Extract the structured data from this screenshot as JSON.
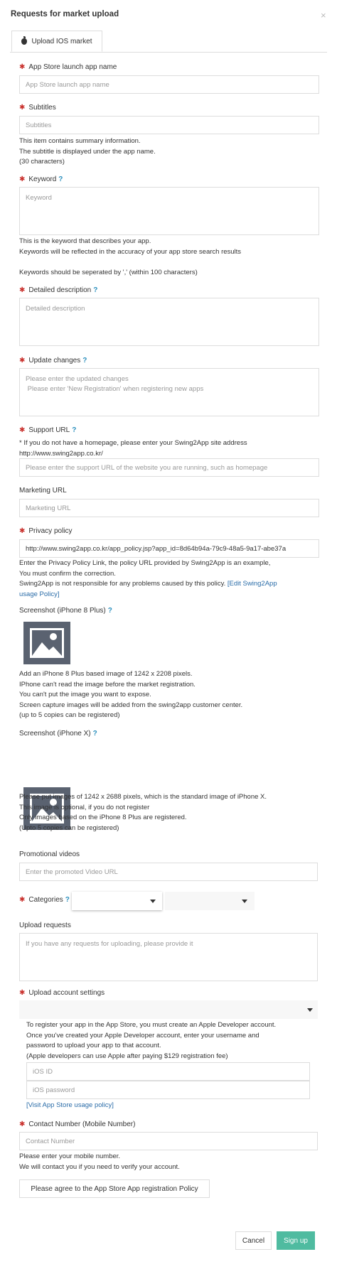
{
  "modal": {
    "title": "Requests for market upload",
    "close": "×"
  },
  "tab": {
    "label": "Upload IOS market"
  },
  "app_name": {
    "label": "App Store launch app name",
    "placeholder": "App Store launch app name"
  },
  "subtitles": {
    "label": "Subtitles",
    "placeholder": "Subtitles",
    "help": [
      "This item contains summary information.",
      "The subtitle is displayed under the app name.",
      "(30 characters)"
    ]
  },
  "keyword": {
    "label": "Keyword",
    "help_mark": "?",
    "placeholder": "Keyword",
    "help": [
      "This is the keyword that describes your app.",
      "Keywords will be reflected in the accuracy of your app store search results"
    ],
    "help2": "Keywords should be seperated by ',' (within 100 characters)"
  },
  "description": {
    "label": "Detailed description",
    "help_mark": "?",
    "placeholder": "Detailed description"
  },
  "update_changes": {
    "label": "Update changes",
    "help_mark": "?",
    "placeholder_1": "Please enter the updated changes",
    "placeholder_2": " Please enter 'New Registration' when registering new apps"
  },
  "support_url": {
    "label": "Support URL",
    "help_mark": "?",
    "note_1": "* If you do not have a homepage, please enter your Swing2App site address",
    "note_2": "http://www.swing2app.co.kr/",
    "placeholder": "Please enter the support URL of the website you are running, such as homepage"
  },
  "marketing_url": {
    "label": "Marketing URL",
    "placeholder": "Marketing URL"
  },
  "privacy_policy": {
    "label": "Privacy policy",
    "value": "http://www.swing2app.co.kr/app_policy.jsp?app_id=8d64b94a-79c9-48a5-9a17-abe37a",
    "help_1": "Enter the Privacy Policy Link, the policy URL provided by Swing2App is an example,",
    "help_2": "You must confirm the correction.",
    "help_3": "Swing2App is not responsible for any problems caused by this policy.",
    "link_1": "[Edit Swing2App",
    "link_2": "usage Policy]"
  },
  "screenshot_8plus": {
    "label": "Screenshot (iPhone 8 Plus)",
    "help_mark": "?",
    "help": [
      "Add an iPhone 8 Plus based image of 1242 x 2208 pixels.",
      "IPhone can't read the image before the market registration.",
      "You can't put the image you want to expose.",
      "Screen capture images will be added from the swing2app customer center.",
      "(up to 5 copies can be registered)"
    ]
  },
  "screenshot_x": {
    "label": "Screenshot (iPhone X)",
    "help_mark": "?",
    "help": [
      "Please put images of 1242 x 2688 pixels, which is the standard image of iPhone X.",
      "This image is optional, if you do not register",
      "Only images based on the iPhone 8 Plus are registered.",
      "(Upto 5 copies can be registered)"
    ]
  },
  "promo_video": {
    "label": "Promotional videos",
    "placeholder": "Enter the promoted Video URL"
  },
  "categories": {
    "label": "Categories",
    "help_mark": "?",
    "primary": "",
    "secondary": ""
  },
  "upload_requests": {
    "label": "Upload requests",
    "placeholder": "If you have any requests for uploading, please provide it"
  },
  "account": {
    "label": "Upload account settings",
    "selected": "",
    "help": [
      "To register your app in the App Store, you must create an Apple Developer account.",
      "Once you've created your Apple Developer account, enter your username and",
      "password to upload your app to that account.",
      "(Apple developers can use Apple after paying $129 registration fee)"
    ],
    "id_placeholder": "iOS ID",
    "pw_placeholder": "iOS password",
    "policy_link": "[Visit App Store usage policy]"
  },
  "contact": {
    "label": "Contact Number (Mobile Number)",
    "placeholder": "Contact Number",
    "help": [
      "Please enter your mobile number.",
      "We will contact you if you need to verify your account."
    ]
  },
  "agree_button": "Please agree to the App Store App registration Policy",
  "footer": {
    "cancel": "Cancel",
    "submit": "Sign up"
  },
  "colors": {
    "accent": "#4fbba0",
    "required": "#c9302c",
    "help_mark": "#2a8fbd",
    "link": "#2a6ca8"
  }
}
